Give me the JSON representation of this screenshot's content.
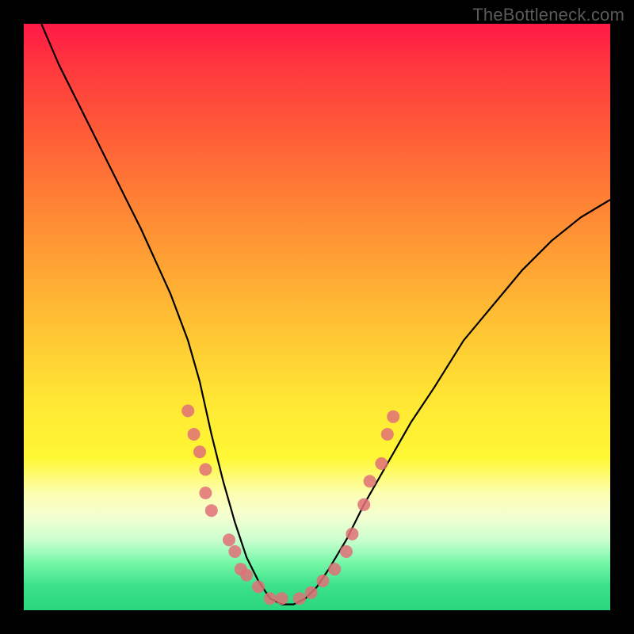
{
  "watermark": "TheBottleneck.com",
  "chart_data": {
    "type": "line",
    "title": "",
    "xlabel": "",
    "ylabel": "",
    "xlim": [
      0,
      100
    ],
    "ylim": [
      0,
      100
    ],
    "series": [
      {
        "name": "bottleneck-curve",
        "x": [
          3,
          6,
          10,
          15,
          20,
          25,
          28,
          30,
          32,
          34,
          36,
          38,
          40,
          42,
          44,
          46,
          48,
          50,
          52,
          55,
          58,
          62,
          66,
          70,
          75,
          80,
          85,
          90,
          95,
          100
        ],
        "values": [
          100,
          93,
          85,
          75,
          65,
          54,
          46,
          39,
          30,
          22,
          15,
          9,
          5,
          2,
          1,
          1,
          2,
          4,
          7,
          12,
          18,
          25,
          32,
          38,
          46,
          52,
          58,
          63,
          67,
          70
        ]
      }
    ],
    "scatter": [
      {
        "name": "left-cluster",
        "color": "#e07078",
        "points": [
          {
            "x": 28,
            "y": 34
          },
          {
            "x": 29,
            "y": 30
          },
          {
            "x": 30,
            "y": 27
          },
          {
            "x": 31,
            "y": 24
          },
          {
            "x": 31,
            "y": 20
          },
          {
            "x": 32,
            "y": 17
          },
          {
            "x": 35,
            "y": 12
          },
          {
            "x": 36,
            "y": 10
          },
          {
            "x": 37,
            "y": 7
          },
          {
            "x": 38,
            "y": 6
          },
          {
            "x": 40,
            "y": 4
          },
          {
            "x": 42,
            "y": 2
          },
          {
            "x": 44,
            "y": 2
          }
        ]
      },
      {
        "name": "right-cluster",
        "color": "#e07078",
        "points": [
          {
            "x": 47,
            "y": 2
          },
          {
            "x": 49,
            "y": 3
          },
          {
            "x": 51,
            "y": 5
          },
          {
            "x": 53,
            "y": 7
          },
          {
            "x": 55,
            "y": 10
          },
          {
            "x": 56,
            "y": 13
          },
          {
            "x": 58,
            "y": 18
          },
          {
            "x": 59,
            "y": 22
          },
          {
            "x": 61,
            "y": 25
          },
          {
            "x": 62,
            "y": 30
          },
          {
            "x": 63,
            "y": 33
          }
        ]
      }
    ],
    "gradient_stops": [
      {
        "pos": 0,
        "color": "#ff1a46"
      },
      {
        "pos": 18,
        "color": "#ff5a38"
      },
      {
        "pos": 48,
        "color": "#ffb834"
      },
      {
        "pos": 74,
        "color": "#fff834"
      },
      {
        "pos": 88,
        "color": "#ccffd0"
      },
      {
        "pos": 100,
        "color": "#2ad77f"
      }
    ]
  }
}
